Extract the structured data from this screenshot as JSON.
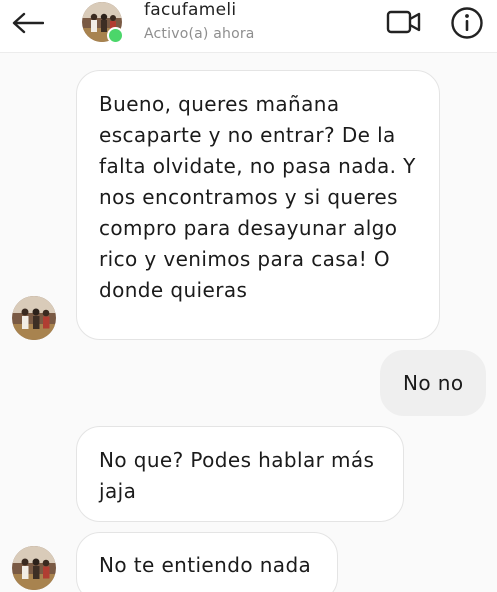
{
  "header": {
    "username": "facufameli",
    "status": "Activo(a) ahora",
    "back_icon": "arrow-left-icon",
    "video_icon": "video-camera-icon",
    "info_icon": "info-circle-icon"
  },
  "messages": [
    {
      "direction": "incoming",
      "text": "Bueno, queres mañana escaparte y no entrar? De la falta olvidate, no pasa nada. Y nos encontramos y si queres compro para desayunar algo rico y venimos para casa! O donde quieras"
    },
    {
      "direction": "outgoing",
      "text": "No no"
    },
    {
      "direction": "incoming",
      "text": "No que? Podes hablar más jaja"
    },
    {
      "direction": "incoming",
      "text": "No te entiendo nada"
    }
  ],
  "colors": {
    "online": "#4bd66a",
    "outgoing_bubble": "#efefef",
    "incoming_border": "#e4e4e4"
  }
}
